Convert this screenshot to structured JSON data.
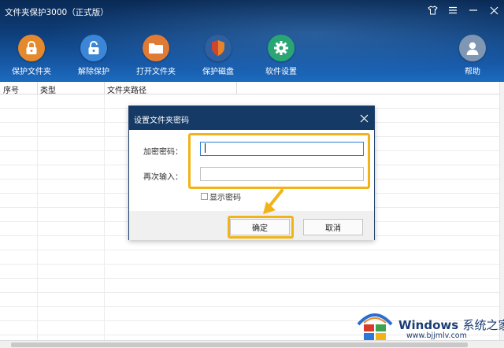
{
  "app": {
    "title": "文件夹保护3000（正式版）"
  },
  "window_controls": [
    {
      "icon": "shirt-icon"
    },
    {
      "icon": "menu-icon"
    },
    {
      "icon": "minimize-icon"
    },
    {
      "icon": "close-icon"
    }
  ],
  "toolbar": {
    "protect": {
      "label": "保护文件夹",
      "icon": "lock-icon",
      "color": "#e48a2c"
    },
    "unprotect": {
      "label": "解除保护",
      "icon": "unlock-icon",
      "color": "#3b86d6"
    },
    "open": {
      "label": "打开文件夹",
      "icon": "folder-icon",
      "color": "#e07b35"
    },
    "disk": {
      "label": "保护磁盘",
      "icon": "shield-icon",
      "color": "#e8832a"
    },
    "settings": {
      "label": "软件设置",
      "icon": "gear-icon",
      "color": "#2aa675"
    },
    "help": {
      "label": "帮助",
      "icon": "user-help-icon",
      "color": "#7f97b3"
    }
  },
  "table": {
    "columns": [
      "序号",
      "类型",
      "文件夹路径"
    ]
  },
  "dialog": {
    "title": "设置文件夹密码",
    "password_label": "加密密码：",
    "password_value": "",
    "confirm_label": "再次输入：",
    "confirm_value": "",
    "show_password_label": "显示密码",
    "show_password_checked": false,
    "ok_label": "确定",
    "cancel_label": "取消"
  },
  "watermark": {
    "brand": "Windows",
    "brand_cn": "系统之家",
    "url": "www.bjjmlv.com"
  },
  "colors": {
    "highlight": "#f2b318",
    "header": "#0d3a73",
    "dialog_title": "#163a66"
  }
}
